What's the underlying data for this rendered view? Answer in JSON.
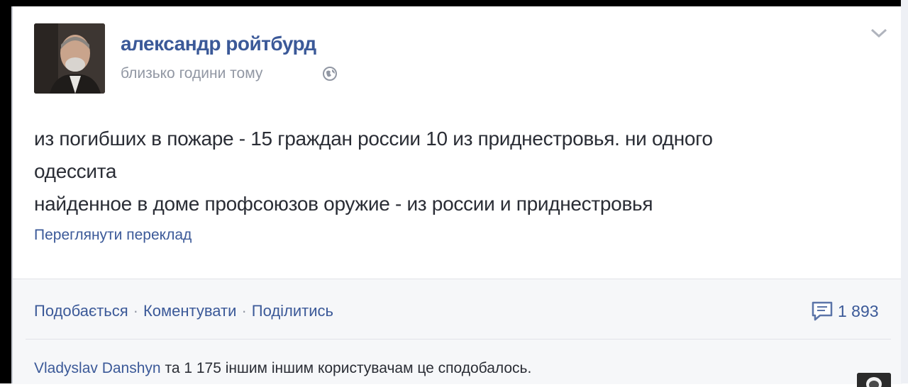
{
  "post": {
    "author": "александр ройтбурд",
    "timestamp": "близько години тому",
    "privacy_icon": "globe-icon",
    "options_icon": "chevron-down-icon",
    "text_lines": [
      "из погибших в пожаре - 15 граждан россии 10 из приднестровья. ни одного",
      "одессита",
      "найденное в доме профсоюзов оружие - из россии и приднестровья"
    ],
    "translate_link": "Переглянути переклад"
  },
  "actions": {
    "like": "Подобається",
    "comment": "Коментувати",
    "share": "Поділитись",
    "separator": "·",
    "comment_count": "1 893",
    "comment_icon": "comment-icon"
  },
  "likes": {
    "name": "Vladyslav Danshyn",
    "rest": "та 1 175 іншим іншим користувачам це сподобалось."
  },
  "colors": {
    "link": "#3b5998",
    "text": "#2a2d35",
    "meta": "#9197a3",
    "footer_bg": "#f6f7f9"
  }
}
